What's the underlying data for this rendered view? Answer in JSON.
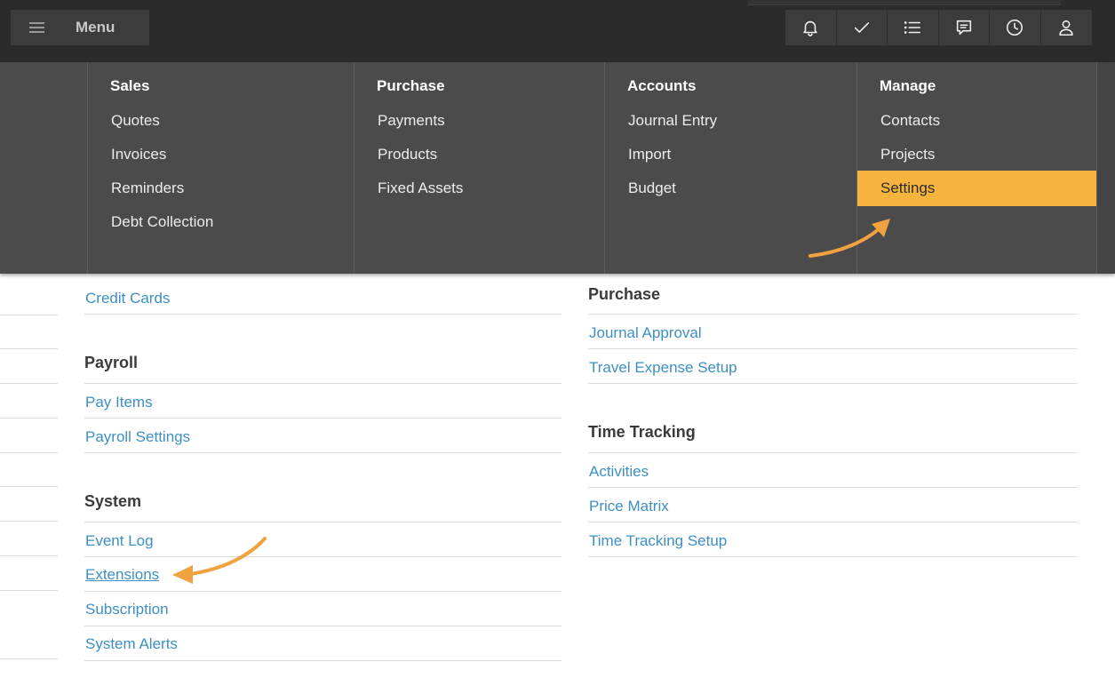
{
  "topbar": {
    "menu_label": "Menu",
    "icons": [
      "bell-icon",
      "check-icon",
      "list-icon",
      "chat-icon",
      "clock-icon",
      "user-icon"
    ]
  },
  "mega_menu": {
    "columns": [
      {
        "title": "Sales",
        "items": [
          "Quotes",
          "Invoices",
          "Reminders",
          "Debt Collection"
        ]
      },
      {
        "title": "Purchase",
        "items": [
          "Payments",
          "Products",
          "Fixed Assets"
        ]
      },
      {
        "title": "Accounts",
        "items": [
          "Journal Entry",
          "Import",
          "Budget"
        ]
      },
      {
        "title": "Manage",
        "items": [
          "Contacts",
          "Projects",
          "Settings"
        ],
        "active": "Settings"
      }
    ],
    "highlight_color": "#f6b43e"
  },
  "settings_left": {
    "top_link": "Credit Cards",
    "payroll": {
      "title": "Payroll",
      "links": [
        "Pay Items",
        "Payroll Settings"
      ]
    },
    "system": {
      "title": "System",
      "links": [
        "Event Log",
        "Extensions",
        "Subscription",
        "System Alerts"
      ]
    }
  },
  "settings_right": {
    "purchase": {
      "title": "Purchase",
      "links": [
        "Journal Approval",
        "Travel Expense Setup"
      ]
    },
    "time_tracking": {
      "title": "Time Tracking",
      "links": [
        "Activities",
        "Price Matrix",
        "Time Tracking Setup"
      ]
    }
  },
  "colors": {
    "link": "#3d8fc4",
    "arrow": "#f0a140",
    "topbar": "#2b2b2b",
    "menu_bg": "#4b4b4b"
  }
}
